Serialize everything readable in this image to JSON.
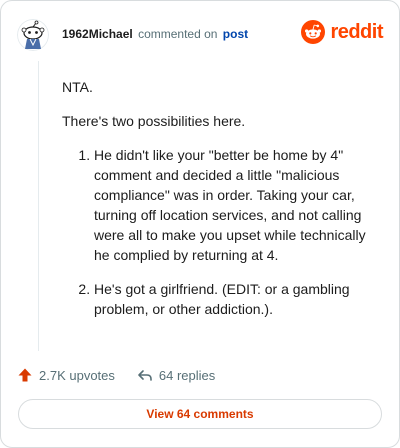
{
  "header": {
    "username": "1962Michael",
    "action_text": "commented on",
    "post_link": "post",
    "brand_icon": "reddit-logo-icon",
    "brand_text": "reddit",
    "brand_color": "#ff4500"
  },
  "comment": {
    "intro": "NTA.",
    "lead": "There's two possibilities here.",
    "items": [
      "He didn't like your \"better be home by 4\" comment and decided a little \"malicious compliance\" was in order. Taking your car, turning off location services, and not calling were all to make you upset while technically he complied by returning at 4.",
      "He's got a girlfriend. (EDIT: or a gambling problem, or other addiction.)."
    ]
  },
  "actions": {
    "upvotes_icon": "upvote-arrow-icon",
    "upvotes": "2.7K upvotes",
    "replies_icon": "reply-arrow-icon",
    "replies": "64 replies"
  },
  "footer": {
    "view_button": "View 64 comments",
    "accent_color": "#d93a00"
  }
}
